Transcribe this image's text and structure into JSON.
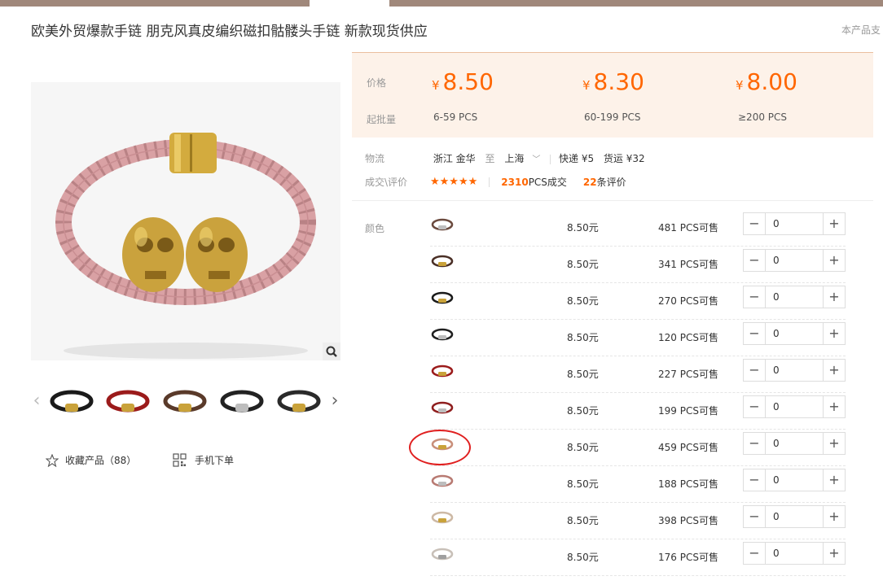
{
  "product": {
    "title": "欧美外贸爆款手链 朋克风真皮编织磁扣骷髅头手链 新款现货供应",
    "support_text": "本产品支"
  },
  "thumbnails": [
    {
      "band_color": "#1a1a1a",
      "clasp_color": "#c9a23a",
      "label": "black-gold"
    },
    {
      "band_color": "#9b1b1b",
      "clasp_color": "#c9a23a",
      "label": "red-gold"
    },
    {
      "band_color": "#5a3a2a",
      "clasp_color": "#c9a23a",
      "label": "brown-gold"
    },
    {
      "band_color": "#222222",
      "clasp_color": "#bdbdbd",
      "label": "black-silver"
    },
    {
      "band_color": "#2a2a2a",
      "clasp_color": "#c9a23a",
      "label": "black-gold-2"
    }
  ],
  "actions": {
    "favorite_label": "收藏产品（88）",
    "mobile_order_label": "手机下单"
  },
  "pricing": {
    "price_label": "价格",
    "moq_label": "起批量",
    "currency": "¥",
    "tiers": [
      {
        "price": "8.50",
        "quantity": "6-59  PCS"
      },
      {
        "price": "8.30",
        "quantity": "60-199  PCS"
      },
      {
        "price": "8.00",
        "quantity": "≥200  PCS"
      }
    ]
  },
  "logistics": {
    "label": "物流",
    "from": "浙江 金华",
    "to_word": "至",
    "to": "上海",
    "express": "快递 ¥5",
    "freight": "货运 ¥32"
  },
  "reviews": {
    "label": "成交\\评价",
    "stars": "★★★★★",
    "sold_count": "2310",
    "sold_suffix": "PCS成交",
    "review_count": "22",
    "review_suffix": "条评价"
  },
  "variants": {
    "label": "颜色",
    "rows": [
      {
        "band_color": "#6b4a3e",
        "clasp_color": "#bfbfbf",
        "price": "8.50元",
        "stock": "481 PCS可售",
        "qty": "0"
      },
      {
        "band_color": "#4a2f26",
        "clasp_color": "#c9a23a",
        "price": "8.50元",
        "stock": "341 PCS可售",
        "qty": "0"
      },
      {
        "band_color": "#1a1a1a",
        "clasp_color": "#c9a23a",
        "price": "8.50元",
        "stock": "270 PCS可售",
        "qty": "0"
      },
      {
        "band_color": "#1f1f1f",
        "clasp_color": "#bdbdbd",
        "price": "8.50元",
        "stock": "120 PCS可售",
        "qty": "0"
      },
      {
        "band_color": "#9b1b1b",
        "clasp_color": "#c9a23a",
        "price": "8.50元",
        "stock": "227 PCS可售",
        "qty": "0"
      },
      {
        "band_color": "#8f1e1e",
        "clasp_color": "#bdbdbd",
        "price": "8.50元",
        "stock": "199 PCS可售",
        "qty": "0"
      },
      {
        "band_color": "#c98f7a",
        "clasp_color": "#c9a23a",
        "price": "8.50元",
        "stock": "459 PCS可售",
        "qty": "0"
      },
      {
        "band_color": "#b87a72",
        "clasp_color": "#bdbdbd",
        "price": "8.50元",
        "stock": "188 PCS可售",
        "qty": "0"
      },
      {
        "band_color": "#cdb9a5",
        "clasp_color": "#c9a23a",
        "price": "8.50元",
        "stock": "398 PCS可售",
        "qty": "0"
      },
      {
        "band_color": "#c8c0b8",
        "clasp_color": "#9f9f9f",
        "price": "8.50元",
        "stock": "176 PCS可售",
        "qty": "0"
      }
    ]
  },
  "colors": {
    "accent": "#ff6600",
    "price_box_bg": "#fdf2e9",
    "nav_bg": "#a0887b",
    "annotation_circle": "#e02020"
  }
}
